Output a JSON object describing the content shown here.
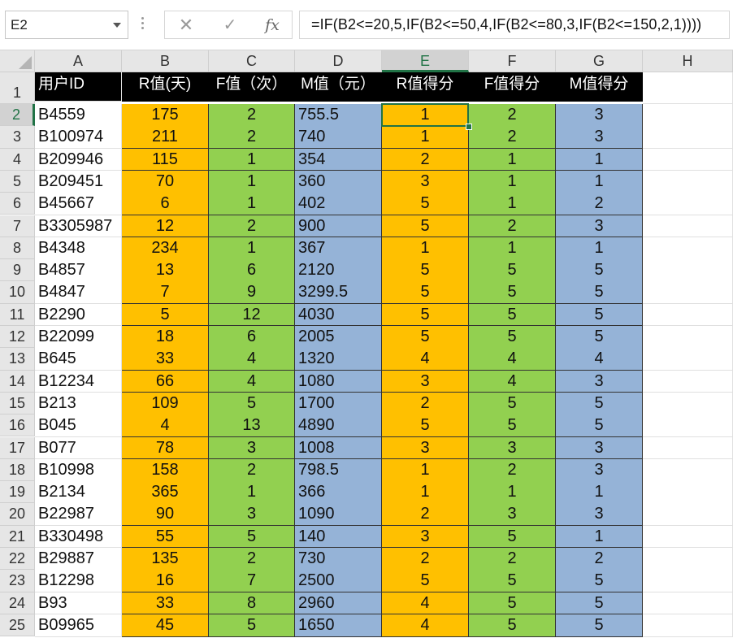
{
  "formula_bar": {
    "name_box": "E2",
    "cancel_icon": "✕",
    "enter_icon": "✓",
    "fx_label": "fx",
    "formula": "=IF(B2<=20,5,IF(B2<=50,4,IF(B2<=80,3,IF(B2<=150,2,1))))"
  },
  "columns": [
    "A",
    "B",
    "C",
    "D",
    "E",
    "F",
    "G",
    "H"
  ],
  "active_column": "E",
  "active_row": 2,
  "headers": [
    "用户ID",
    "R值(天)",
    "F值（次）",
    "M值（元）",
    "R值得分",
    "F值得分",
    "M值得分"
  ],
  "rows": [
    {
      "n": "2",
      "id": "B4559",
      "r": "175",
      "f": "2",
      "m": "755.5",
      "rs": "1",
      "fs": "2",
      "ms": "3"
    },
    {
      "n": "3",
      "id": "B100974",
      "r": "211",
      "f": "2",
      "m": "740",
      "rs": "1",
      "fs": "2",
      "ms": "3"
    },
    {
      "n": "4",
      "id": "B209946",
      "r": "115",
      "f": "1",
      "m": "354",
      "rs": "2",
      "fs": "1",
      "ms": "1"
    },
    {
      "n": "5",
      "id": "B209451",
      "r": "70",
      "f": "1",
      "m": "360",
      "rs": "3",
      "fs": "1",
      "ms": "1"
    },
    {
      "n": "6",
      "id": "B45667",
      "r": "6",
      "f": "1",
      "m": "402",
      "rs": "5",
      "fs": "1",
      "ms": "2"
    },
    {
      "n": "7",
      "id": "B3305987",
      "r": "12",
      "f": "2",
      "m": "900",
      "rs": "5",
      "fs": "2",
      "ms": "3"
    },
    {
      "n": "8",
      "id": "B4348",
      "r": "234",
      "f": "1",
      "m": "367",
      "rs": "1",
      "fs": "1",
      "ms": "1"
    },
    {
      "n": "9",
      "id": "B4857",
      "r": "13",
      "f": "6",
      "m": "2120",
      "rs": "5",
      "fs": "5",
      "ms": "5"
    },
    {
      "n": "10",
      "id": "B4847",
      "r": "7",
      "f": "9",
      "m": "3299.5",
      "rs": "5",
      "fs": "5",
      "ms": "5"
    },
    {
      "n": "11",
      "id": "B2290",
      "r": "5",
      "f": "12",
      "m": "4030",
      "rs": "5",
      "fs": "5",
      "ms": "5"
    },
    {
      "n": "12",
      "id": "B22099",
      "r": "18",
      "f": "6",
      "m": "2005",
      "rs": "5",
      "fs": "5",
      "ms": "5"
    },
    {
      "n": "13",
      "id": "B645",
      "r": "33",
      "f": "4",
      "m": "1320",
      "rs": "4",
      "fs": "4",
      "ms": "4"
    },
    {
      "n": "14",
      "id": "B12234",
      "r": "66",
      "f": "4",
      "m": "1080",
      "rs": "3",
      "fs": "4",
      "ms": "3"
    },
    {
      "n": "15",
      "id": "B213",
      "r": "109",
      "f": "5",
      "m": "1700",
      "rs": "2",
      "fs": "5",
      "ms": "5"
    },
    {
      "n": "16",
      "id": "B045",
      "r": "4",
      "f": "13",
      "m": "4890",
      "rs": "5",
      "fs": "5",
      "ms": "5"
    },
    {
      "n": "17",
      "id": "B077",
      "r": "78",
      "f": "3",
      "m": "1008",
      "rs": "3",
      "fs": "3",
      "ms": "3"
    },
    {
      "n": "18",
      "id": "B10998",
      "r": "158",
      "f": "2",
      "m": "798.5",
      "rs": "1",
      "fs": "2",
      "ms": "3"
    },
    {
      "n": "19",
      "id": "B2134",
      "r": "365",
      "f": "1",
      "m": "366",
      "rs": "1",
      "fs": "1",
      "ms": "1"
    },
    {
      "n": "20",
      "id": "B22987",
      "r": "90",
      "f": "3",
      "m": "1090",
      "rs": "2",
      "fs": "3",
      "ms": "3"
    },
    {
      "n": "21",
      "id": "B330498",
      "r": "55",
      "f": "5",
      "m": "140",
      "rs": "3",
      "fs": "5",
      "ms": "1"
    },
    {
      "n": "22",
      "id": "B29887",
      "r": "135",
      "f": "2",
      "m": "730",
      "rs": "2",
      "fs": "2",
      "ms": "2"
    },
    {
      "n": "23",
      "id": "B12298",
      "r": "16",
      "f": "7",
      "m": "2500",
      "rs": "5",
      "fs": "5",
      "ms": "5"
    },
    {
      "n": "24",
      "id": "B93",
      "r": "33",
      "f": "8",
      "m": "2960",
      "rs": "4",
      "fs": "5",
      "ms": "5"
    },
    {
      "n": "25",
      "id": "B09965",
      "r": "45",
      "f": "5",
      "m": "1650",
      "rs": "4",
      "fs": "5",
      "ms": "5"
    }
  ],
  "colors": {
    "r_fill": "#ffc000",
    "f_fill": "#92d050",
    "m_fill": "#95b3d7",
    "header_fill": "#000000",
    "selection": "#217346"
  }
}
